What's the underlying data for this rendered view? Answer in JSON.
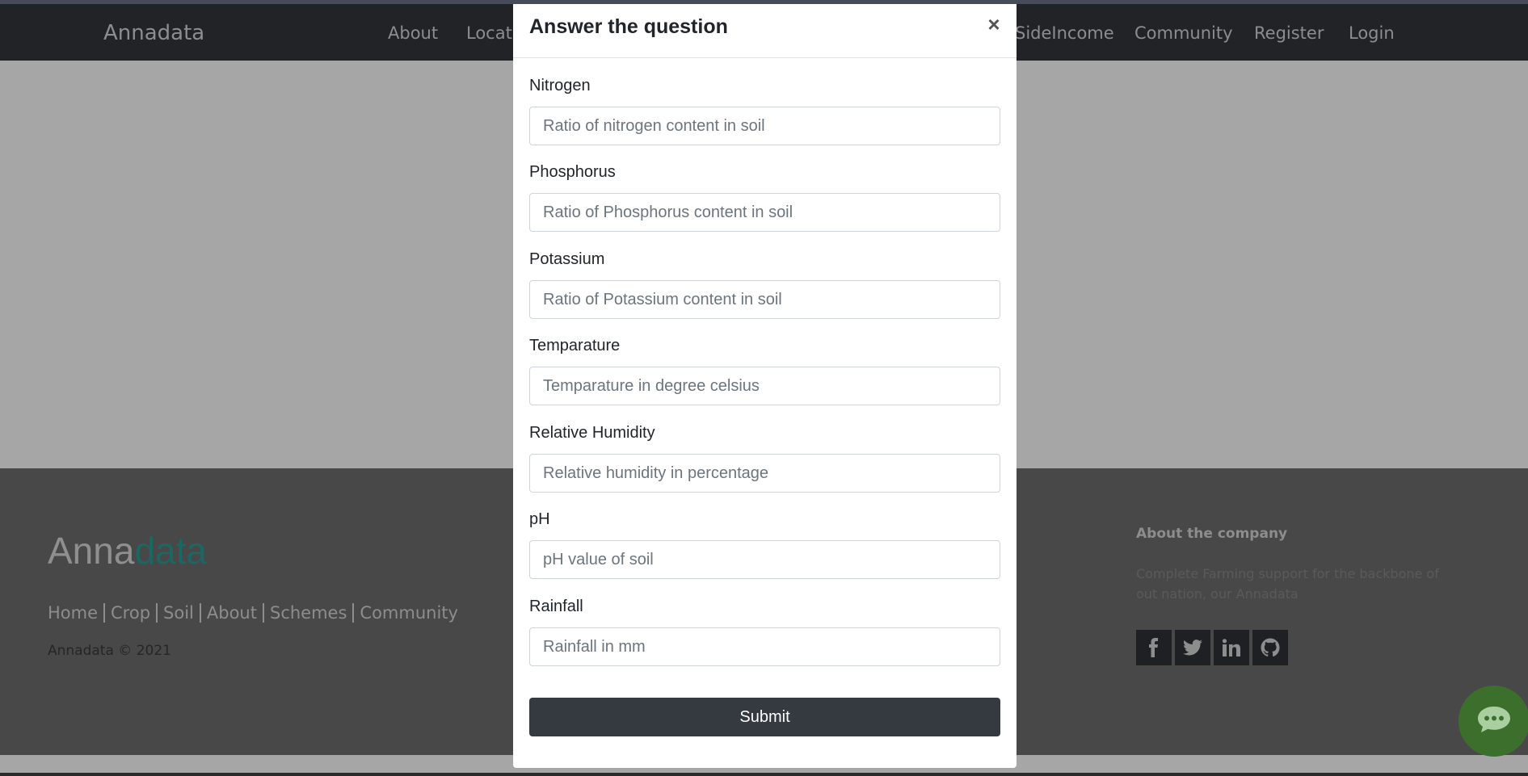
{
  "navbar": {
    "brand": "Annadata",
    "links": [
      {
        "label": "About"
      },
      {
        "label": "Locati"
      },
      {
        "label": "SideIncome"
      },
      {
        "label": "Community"
      },
      {
        "label": "Register"
      },
      {
        "label": "Login"
      }
    ]
  },
  "footer": {
    "brand_part1": "Anna",
    "brand_part2": "data",
    "links": [
      "Home",
      "Crop",
      "Soil",
      "About",
      "Schemes",
      "Community"
    ],
    "copyright": "Annadata © 2021",
    "about_title": "About the company",
    "about_text": "Complete Farming support for the backbone of out nation, our Annadata",
    "social_icons": [
      "facebook-icon",
      "twitter-icon",
      "linkedin-icon",
      "github-icon"
    ]
  },
  "modal": {
    "title": "Answer the question",
    "close_symbol": "×",
    "fields": [
      {
        "label": "Nitrogen",
        "placeholder": "Ratio of nitrogen content in soil"
      },
      {
        "label": "Phosphorus",
        "placeholder": "Ratio of Phosphorus content in soil"
      },
      {
        "label": "Potassium",
        "placeholder": "Ratio of Potassium content in soil"
      },
      {
        "label": "Temparature",
        "placeholder": "Temparature in degree celsius"
      },
      {
        "label": "Relative Humidity",
        "placeholder": "Relative humidity in percentage"
      },
      {
        "label": "pH",
        "placeholder": "pH value of soil"
      },
      {
        "label": "Rainfall",
        "placeholder": "Rainfall in mm"
      }
    ],
    "submit_label": "Submit"
  },
  "colors": {
    "navbar_bg": "#212327",
    "footer_bg": "#484848",
    "brand_accent": "#1c6663",
    "submit_bg": "#343a40",
    "chat_bg": "#3c6f2c"
  }
}
